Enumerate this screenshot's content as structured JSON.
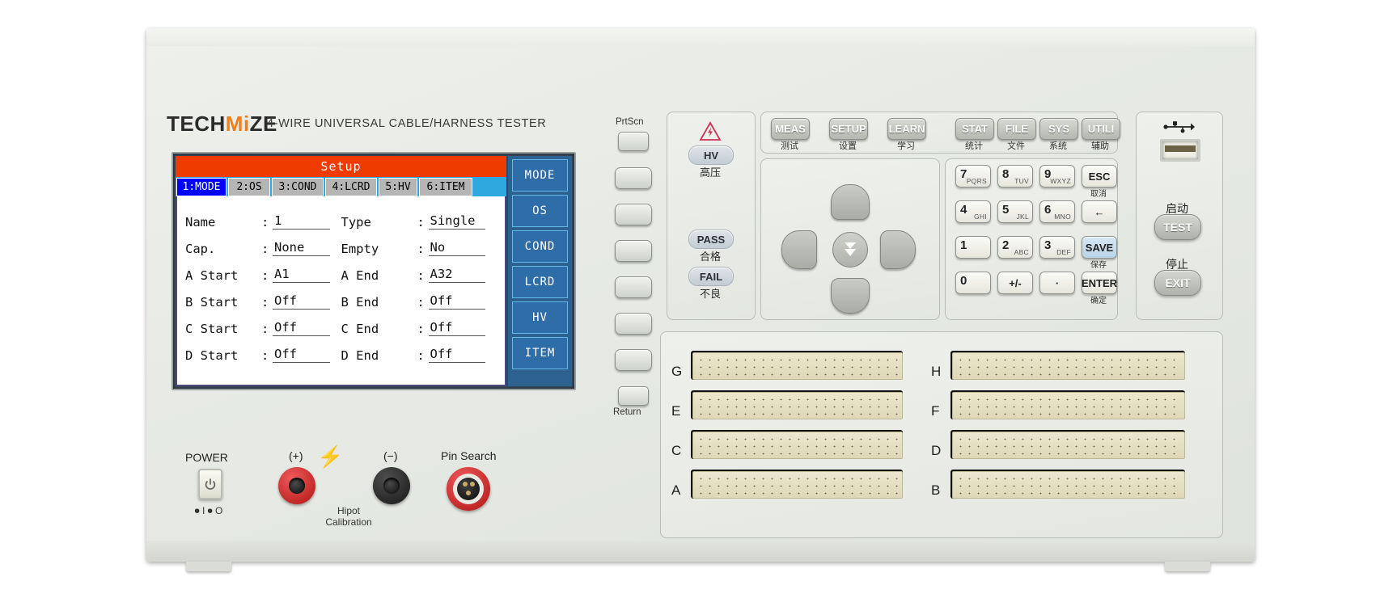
{
  "device": {
    "brand_prefix": "TECH",
    "brand_mid": "Mi",
    "brand_suffix": "ZE",
    "subtitle": "4-WIRE  UNIVERSAL  CABLE/HARNESS  TESTER"
  },
  "screen": {
    "title": "Setup",
    "tabs": [
      {
        "label": "1:MODE",
        "active": true
      },
      {
        "label": "2:OS",
        "active": false
      },
      {
        "label": "3:COND",
        "active": false
      },
      {
        "label": "4:LCRD",
        "active": false
      },
      {
        "label": "5:HV",
        "active": false
      },
      {
        "label": "6:ITEM",
        "active": false
      }
    ],
    "fields": [
      {
        "left_label": "Name",
        "left_value": "1",
        "right_label": "Type",
        "right_value": "Single"
      },
      {
        "left_label": "Cap.",
        "left_value": "None",
        "right_label": "Empty",
        "right_value": "No"
      },
      {
        "left_label": "A Start",
        "left_value": "A1",
        "right_label": "A End",
        "right_value": "A32"
      },
      {
        "left_label": "B Start",
        "left_value": "Off",
        "right_label": "B End",
        "right_value": "Off"
      },
      {
        "left_label": "C Start",
        "left_value": "Off",
        "right_label": "C End",
        "right_value": "Off"
      },
      {
        "left_label": "D Start",
        "left_value": "Off",
        "right_label": "D End",
        "right_value": "Off"
      }
    ],
    "softkeys": [
      "MODE",
      "OS",
      "COND",
      "LCRD",
      "HV",
      "ITEM"
    ],
    "colors": {
      "title_bar": "#ef3b00",
      "tab_active": "#0000ff",
      "tab_bar": "#2fa8e0",
      "softkey_panel": "#2c6190"
    }
  },
  "bezel": {
    "prtscn_label": "PrtScn",
    "return_label": "Return"
  },
  "indicators": {
    "hazard_icon": "high-voltage-warning-icon",
    "items": [
      {
        "label": "HV",
        "cn": "高压"
      },
      {
        "label": "PASS",
        "cn": "合格"
      },
      {
        "label": "FAIL",
        "cn": "不良"
      }
    ]
  },
  "function_keys": [
    {
      "label": "MEAS",
      "cn": "测试"
    },
    {
      "label": "SETUP",
      "cn": "设置"
    },
    {
      "label": "LEARN",
      "cn": "学习"
    },
    {
      "label": "STAT",
      "cn": "统计"
    },
    {
      "label": "FILE",
      "cn": "文件"
    },
    {
      "label": "SYS",
      "cn": "系统"
    },
    {
      "label": "UTILI",
      "cn": "辅助"
    }
  ],
  "navigation": {
    "up": "up-arrow-key",
    "down": "down-arrow-key",
    "left": "left-arrow-key",
    "right": "right-arrow-key",
    "center_glyph": "⏷"
  },
  "keypad": [
    {
      "num": "7",
      "alpha": "PQRS"
    },
    {
      "num": "8",
      "alpha": "TUV"
    },
    {
      "num": "9",
      "alpha": "WXYZ"
    },
    {
      "text": "ESC",
      "cn": "取消"
    },
    {
      "num": "4",
      "alpha": "GHI"
    },
    {
      "num": "5",
      "alpha": "JKL"
    },
    {
      "num": "6",
      "alpha": "MNO"
    },
    {
      "text": "←",
      "cn": ""
    },
    {
      "num": "1",
      "alpha": ""
    },
    {
      "num": "2",
      "alpha": "ABC"
    },
    {
      "num": "3",
      "alpha": "DEF"
    },
    {
      "text": "SAVE",
      "cn": "保存",
      "highlight": true
    },
    {
      "num": "0",
      "alpha": ""
    },
    {
      "text": "+/-",
      "cn": ""
    },
    {
      "text": "·",
      "cn": ""
    },
    {
      "text": "ENTER",
      "cn": "确定"
    }
  ],
  "right_panel": {
    "usb_icon": "usb-icon",
    "test": {
      "label": "TEST",
      "cn": "启动"
    },
    "exit": {
      "label": "EXIT",
      "cn": "停止"
    }
  },
  "bottom_left": {
    "power_label": "POWER",
    "power_icon": "power-icon",
    "power_marks": "⏺ I ⏺ O",
    "plus_label": "(+)",
    "minus_label": "(−)",
    "bolt_icon": "lightning-bolt-icon",
    "hipot_caption": "Hipot\nCalibration",
    "pin_search_label": "Pin Search"
  },
  "connectors": {
    "left_column": [
      "G",
      "E",
      "C",
      "A"
    ],
    "right_column": [
      "H",
      "F",
      "D",
      "B"
    ]
  }
}
